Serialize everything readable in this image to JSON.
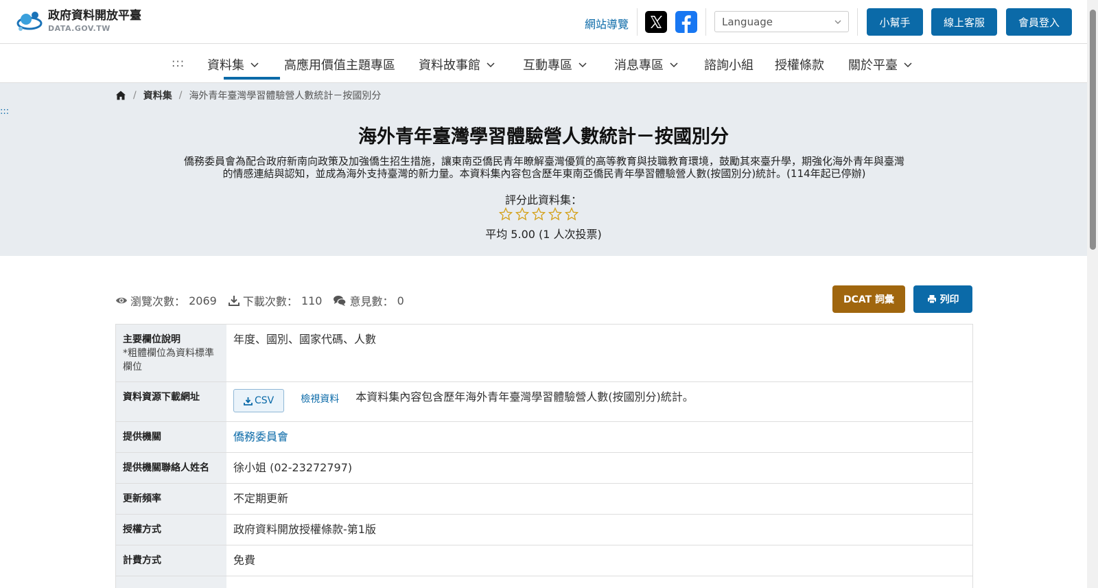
{
  "header": {
    "logo_cn": "政府資料開放平臺",
    "logo_en": "DATA.GOV.TW",
    "sitemap": "網站導覽",
    "language_placeholder": "Language",
    "buttons": [
      "小幫手",
      "線上客服",
      "會員登入"
    ],
    "brand_color": "#0b6aa8"
  },
  "nav": {
    "accesskey": ":::",
    "items": [
      {
        "label": "資料集",
        "dropdown": true,
        "active": true
      },
      {
        "label": "高應用價值主題專區",
        "dropdown": false
      },
      {
        "label": "資料故事館",
        "dropdown": true
      },
      {
        "label": "互動專區",
        "dropdown": true
      },
      {
        "label": "消息專區",
        "dropdown": true
      },
      {
        "label": "諮詢小組",
        "dropdown": false
      },
      {
        "label": "授權條款",
        "dropdown": false
      },
      {
        "label": "關於平臺",
        "dropdown": true
      }
    ]
  },
  "breadcrumb": {
    "section": "資料集",
    "current": "海外青年臺灣學習體驗營人數統計－按國別分"
  },
  "side_accesskey": ":::",
  "dataset": {
    "title": "海外青年臺灣學習體驗營人數統計－按國別分",
    "description": "僑務委員會為配合政府新南向政策及加強僑生招生措施，讓東南亞僑民青年瞭解臺灣優質的高等教育與技職教育環境，鼓勵其來臺升學，期強化海外青年與臺灣的情感連結與認知，並成為海外支持臺灣的新力量。本資料集內容包含歷年東南亞僑民青年學習體驗營人數(按國別分)統計。(114年起已停辦)",
    "rate_label": "評分此資料集：",
    "star_count": 5,
    "rating_avg": "平均 5.00 (1 人次投票)"
  },
  "stats": {
    "views_label": "瀏覽次數：",
    "views": "2069",
    "downloads_label": "下載次數：",
    "downloads": "110",
    "comments_label": "意見數：",
    "comments": "0",
    "dcat_button": "DCAT 詞彙",
    "print_button": "列印"
  },
  "info": {
    "fields_label": "主要欄位說明",
    "fields_note": "*粗體欄位為資料標準欄位",
    "fields_value": "年度、國別、國家代碼、人數",
    "download_label": "資料資源下載網址",
    "csv_button": "CSV",
    "view_link": "檢視資料",
    "download_desc": "本資料集內容包含歷年海外青年臺灣學習體驗營人數(按國別分)統計。",
    "provider_label": "提供機關",
    "provider_value": "僑務委員會",
    "contact_label": "提供機關聯絡人姓名",
    "contact_value": "徐小姐 (02-23272797)",
    "frequency_label": "更新頻率",
    "frequency_value": "不定期更新",
    "license_label": "授權方式",
    "license_value": "政府資料開放授權條款-第1版",
    "fee_label": "計費方式",
    "fee_value": "免費"
  }
}
